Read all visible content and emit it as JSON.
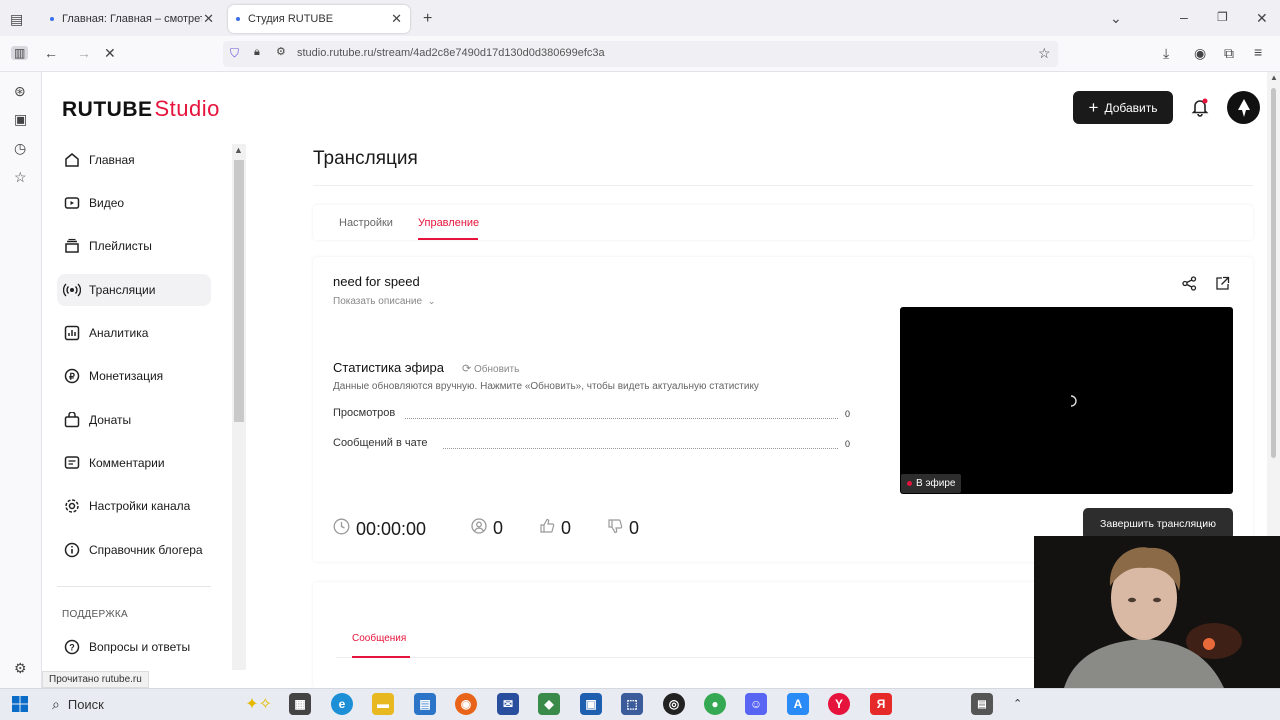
{
  "browser": {
    "tabs": [
      {
        "title": "Главная: Главная – смотреть о",
        "active": false
      },
      {
        "title": "Студия RUTUBE",
        "active": true
      }
    ],
    "url": "studio.rutube.ru/stream/4ad2c8e7490d17d130d0d380699efc3a"
  },
  "header": {
    "logo_main": "RUTUBE",
    "logo_studio": "Studio",
    "add_label": "Добавить"
  },
  "sidebar": {
    "items": [
      {
        "label": "Главная",
        "icon": "home-icon"
      },
      {
        "label": "Видео",
        "icon": "video-icon"
      },
      {
        "label": "Плейлисты",
        "icon": "playlist-icon"
      },
      {
        "label": "Трансляции",
        "icon": "broadcast-icon",
        "active": true
      },
      {
        "label": "Аналитика",
        "icon": "analytics-icon"
      },
      {
        "label": "Монетизация",
        "icon": "monetization-icon"
      },
      {
        "label": "Донаты",
        "icon": "donate-icon"
      },
      {
        "label": "Комментарии",
        "icon": "comments-icon"
      },
      {
        "label": "Настройки канала",
        "icon": "settings-icon"
      },
      {
        "label": "Справочник блогера",
        "icon": "info-icon"
      }
    ],
    "support_heading": "ПОДДЕРЖКА",
    "faq_label": "Вопросы и ответы"
  },
  "main": {
    "title": "Трансляция",
    "tabs": [
      {
        "label": "Настройки"
      },
      {
        "label": "Управление",
        "selected": true
      }
    ],
    "stream_name": "need for speed",
    "show_description": "Показать описание",
    "stats": {
      "title": "Статистика эфира",
      "refresh_label": "Обновить",
      "hint": "Данные обновляются вручную. Нажмите «Обновить», чтобы видеть актуальную статистику",
      "rows": [
        {
          "label": "Просмотров",
          "value": "0"
        },
        {
          "label": "Сообщений в чате",
          "value": "0"
        }
      ]
    },
    "player": {
      "live_label": "В эфире"
    },
    "metrics": {
      "duration": "00:00:00",
      "viewers": "0",
      "likes": "0",
      "dislikes": "0"
    },
    "end_button": "Завершить трансляцию",
    "messages_tab": "Сообщения"
  },
  "statusbar": {
    "text": "Прочитано rutube.ru"
  },
  "taskbar": {
    "search_label": "Поиск"
  },
  "colors": {
    "accent": "#e6143c",
    "dark_button": "#1a1a1a"
  }
}
